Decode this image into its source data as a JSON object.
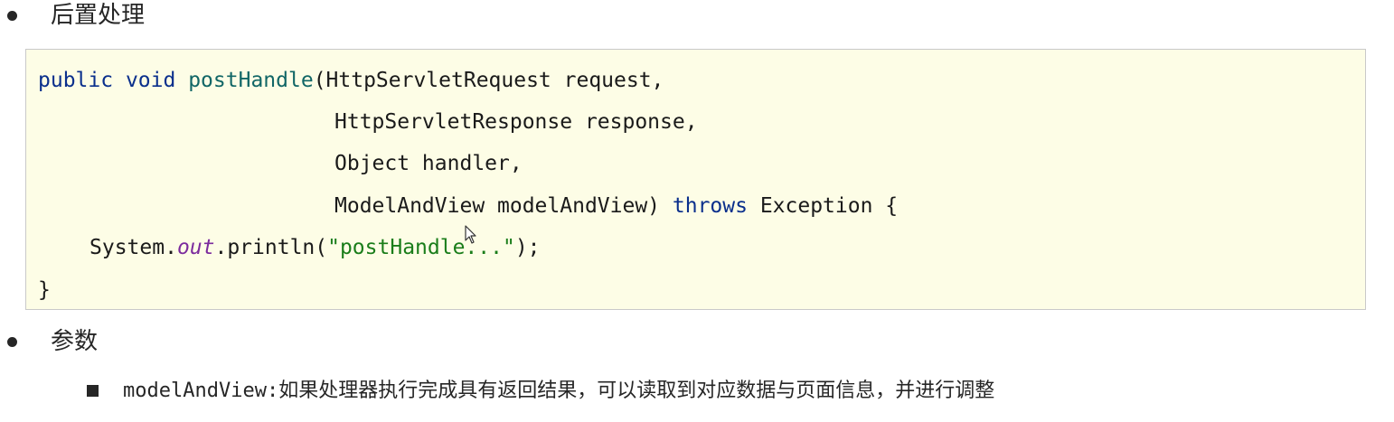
{
  "section1": {
    "heading": "后置处理"
  },
  "code": {
    "line1": {
      "kw1": "public",
      "kw2": "void",
      "fn": "postHandle",
      "rest": "(HttpServletRequest request,"
    },
    "line2": "HttpServletResponse response,",
    "line3": "Object handler,",
    "line4": {
      "pre": "ModelAndView modelAndView) ",
      "kw": "throws",
      "post": " Exception {"
    },
    "line5": {
      "pre": "System.",
      "field": "out",
      "mid": ".println(",
      "str": "\"postHandle...\"",
      "post": ");"
    },
    "line6": "}"
  },
  "section2": {
    "heading": "参数",
    "items": [
      {
        "name": "modelAndView:",
        "desc": "如果处理器执行完成具有返回结果，可以读取到对应数据与页面信息，并进行调整"
      }
    ]
  },
  "colors": {
    "code_background": "#fdfde6",
    "keyword": "#0a2f8c",
    "method_name": "#116666",
    "string": "#1a7d1a",
    "static_field": "#7b2b9d"
  }
}
